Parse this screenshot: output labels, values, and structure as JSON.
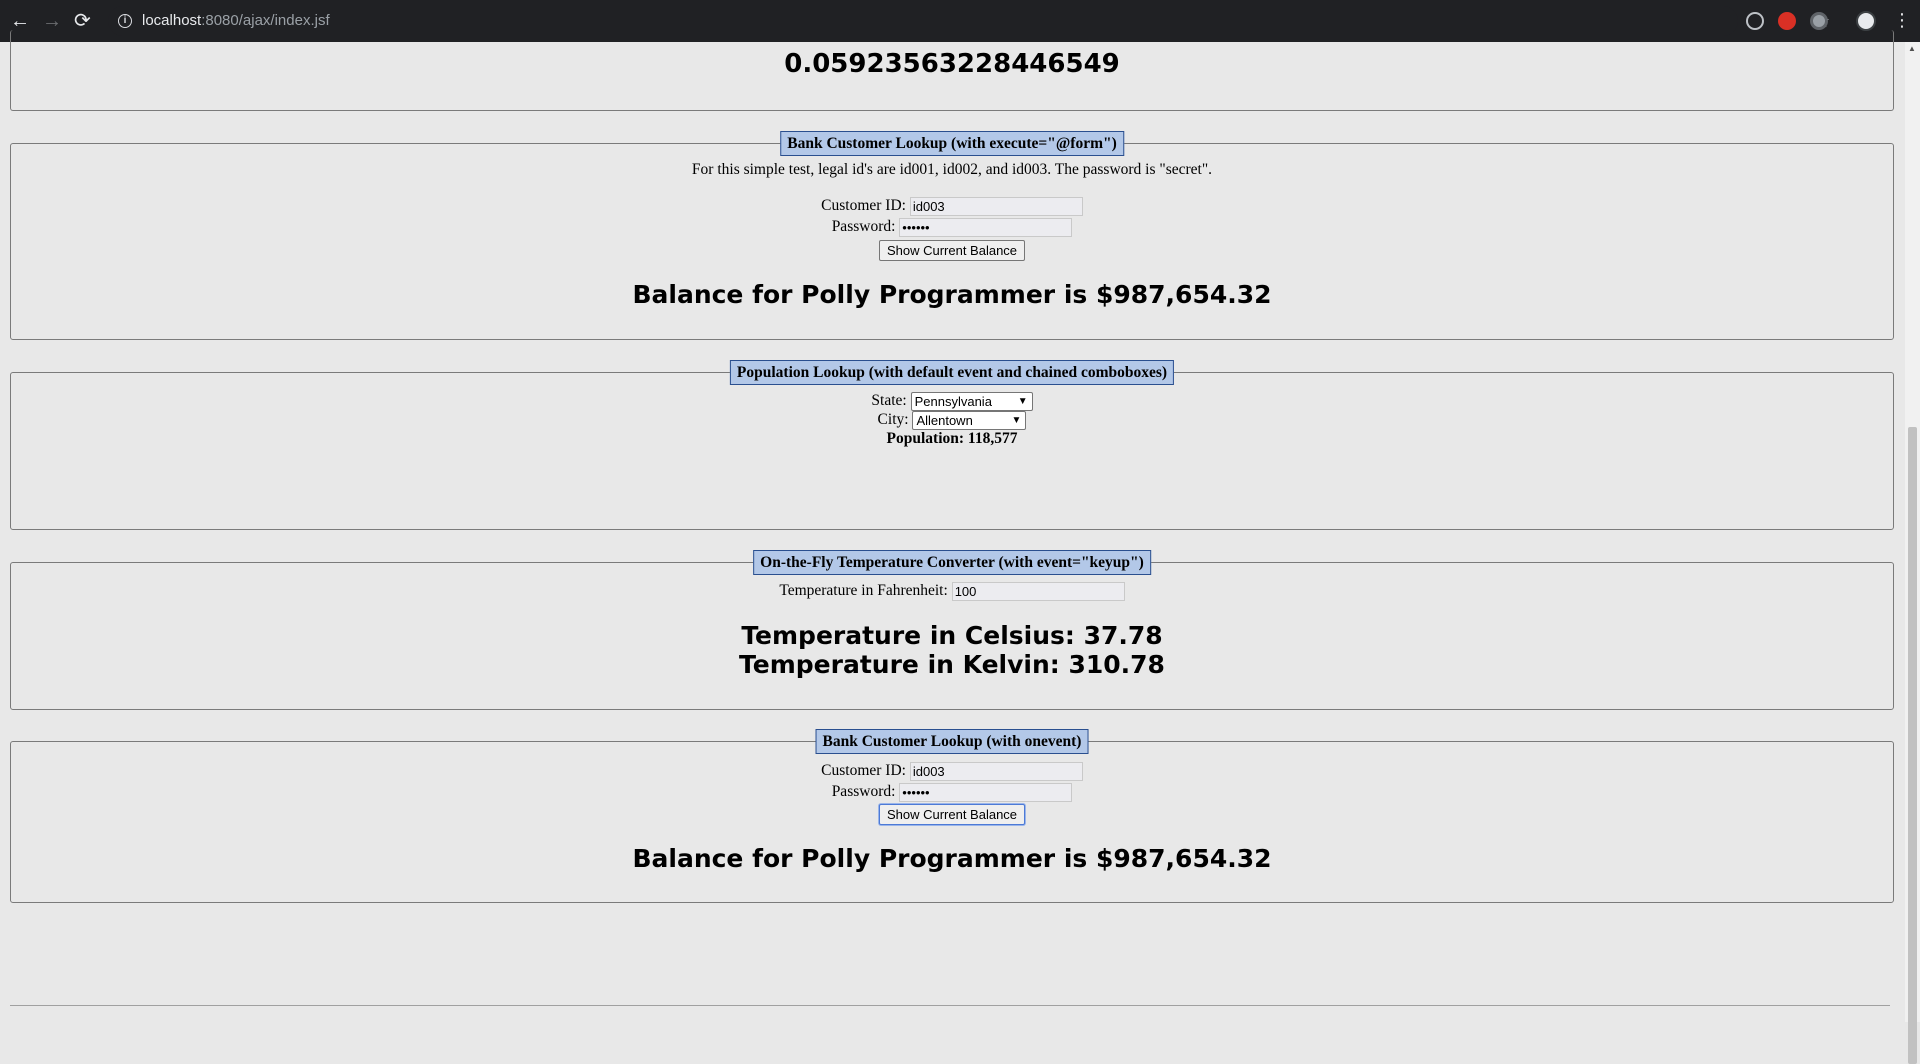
{
  "browser": {
    "url_host": "localhost",
    "url_path": ":8080/ajax/index.jsf",
    "back_icon": "←",
    "forward_icon": "→",
    "reload_icon": "⟳",
    "star_icon": "☆",
    "menu_icon": "⋮",
    "info_icon": "i"
  },
  "top_panel": {
    "random_value": "0.05923563228446549"
  },
  "bank_form": {
    "legend": "Bank Customer Lookup (with execute=\"@form\")",
    "note": "For this simple test, legal id's are id001, id002, and id003. The password is \"secret\".",
    "customer_id_label": "Customer ID:",
    "customer_id_value": "id003",
    "password_label": "Password:",
    "password_value": "••••••",
    "button_label": "Show Current Balance",
    "result": "Balance for Polly Programmer is $987,654.32"
  },
  "population": {
    "legend": "Population Lookup (with default event and chained comboboxes)",
    "state_label": "State:",
    "state_value": "Pennsylvania",
    "city_label": "City:",
    "city_value": "Allentown",
    "population_text": "Population: 118,577"
  },
  "temperature": {
    "legend": "On-the-Fly Temperature Converter (with event=\"keyup\")",
    "fahrenheit_label": "Temperature in Fahrenheit:",
    "fahrenheit_value": "100",
    "celsius_text": "Temperature in Celsius: 37.78",
    "kelvin_text": "Temperature in Kelvin: 310.78"
  },
  "bank_onevent": {
    "legend": "Bank Customer Lookup (with onevent)",
    "customer_id_label": "Customer ID:",
    "customer_id_value": "id003",
    "password_label": "Password:",
    "password_value": "••••••",
    "button_label": "Show Current Balance",
    "result": "Balance for Polly Programmer is $987,654.32"
  }
}
